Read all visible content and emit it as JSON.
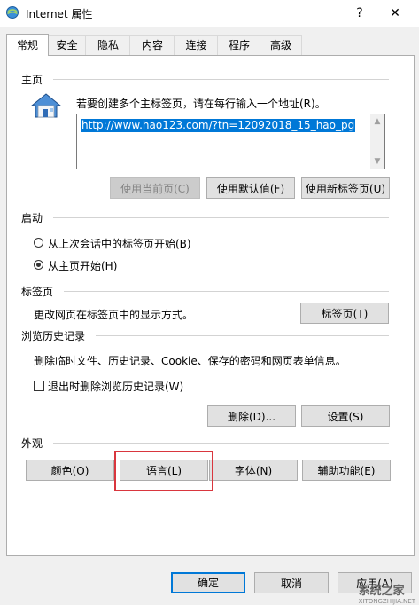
{
  "window": {
    "title": "Internet 属性",
    "help": "?",
    "close": "✕"
  },
  "tabs": [
    "常规",
    "安全",
    "隐私",
    "内容",
    "连接",
    "程序",
    "高级"
  ],
  "home": {
    "section": "主页",
    "instruction": "若要创建多个主标签页，请在每行输入一个地址(R)。",
    "url": "http://www.hao123.com/?tn=12092018_15_hao_pg",
    "buttons": [
      "使用当前页(C)",
      "使用默认值(F)",
      "使用新标签页(U)"
    ]
  },
  "startup": {
    "section": "启动",
    "options": [
      "从上次会话中的标签页开始(B)",
      "从主页开始(H)"
    ],
    "selected": 1
  },
  "tabsection": {
    "section": "标签页",
    "desc": "更改网页在标签页中的显示方式。",
    "button": "标签页(T)"
  },
  "history": {
    "section": "浏览历史记录",
    "desc": "删除临时文件、历史记录、Cookie、保存的密码和网页表单信息。",
    "checkbox": "退出时删除浏览历史记录(W)",
    "buttons": [
      "删除(D)...",
      "设置(S)"
    ]
  },
  "appearance": {
    "section": "外观",
    "buttons": [
      "颜色(O)",
      "语言(L)",
      "字体(N)",
      "辅助功能(E)"
    ]
  },
  "footer": {
    "ok": "确定",
    "cancel": "取消",
    "apply": "应用(A)"
  },
  "watermark": {
    "text": "系统之家",
    "url": "XITONGZHIJIA.NET"
  }
}
